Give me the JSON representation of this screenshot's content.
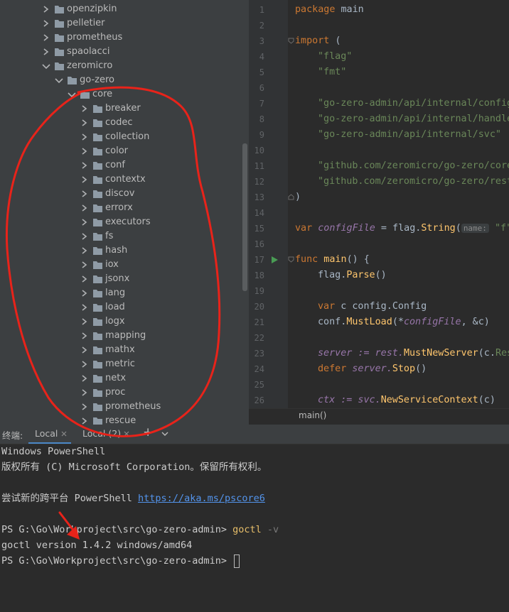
{
  "project_tree": {
    "items": [
      {
        "label": "openzipkin",
        "depth": 0,
        "expanded": false
      },
      {
        "label": "pelletier",
        "depth": 0,
        "expanded": false
      },
      {
        "label": "prometheus",
        "depth": 0,
        "expanded": false
      },
      {
        "label": "spaolacci",
        "depth": 0,
        "expanded": false
      },
      {
        "label": "zeromicro",
        "depth": 0,
        "expanded": true
      },
      {
        "label": "go-zero",
        "depth": 1,
        "expanded": true
      },
      {
        "label": "core",
        "depth": 2,
        "expanded": true
      },
      {
        "label": "breaker",
        "depth": 3,
        "expanded": false
      },
      {
        "label": "codec",
        "depth": 3,
        "expanded": false
      },
      {
        "label": "collection",
        "depth": 3,
        "expanded": false
      },
      {
        "label": "color",
        "depth": 3,
        "expanded": false
      },
      {
        "label": "conf",
        "depth": 3,
        "expanded": false
      },
      {
        "label": "contextx",
        "depth": 3,
        "expanded": false
      },
      {
        "label": "discov",
        "depth": 3,
        "expanded": false
      },
      {
        "label": "errorx",
        "depth": 3,
        "expanded": false
      },
      {
        "label": "executors",
        "depth": 3,
        "expanded": false
      },
      {
        "label": "fs",
        "depth": 3,
        "expanded": false
      },
      {
        "label": "hash",
        "depth": 3,
        "expanded": false
      },
      {
        "label": "iox",
        "depth": 3,
        "expanded": false
      },
      {
        "label": "jsonx",
        "depth": 3,
        "expanded": false
      },
      {
        "label": "lang",
        "depth": 3,
        "expanded": false
      },
      {
        "label": "load",
        "depth": 3,
        "expanded": false
      },
      {
        "label": "logx",
        "depth": 3,
        "expanded": false
      },
      {
        "label": "mapping",
        "depth": 3,
        "expanded": false
      },
      {
        "label": "mathx",
        "depth": 3,
        "expanded": false
      },
      {
        "label": "metric",
        "depth": 3,
        "expanded": false
      },
      {
        "label": "netx",
        "depth": 3,
        "expanded": false
      },
      {
        "label": "proc",
        "depth": 3,
        "expanded": false
      },
      {
        "label": "prometheus",
        "depth": 3,
        "expanded": false
      },
      {
        "label": "rescue",
        "depth": 3,
        "expanded": false
      }
    ]
  },
  "editor": {
    "line_numbers": [
      "1",
      "2",
      "3",
      "4",
      "5",
      "6",
      "7",
      "8",
      "9",
      "10",
      "11",
      "12",
      "13",
      "14",
      "15",
      "16",
      "17",
      "18",
      "19",
      "20",
      "21",
      "22",
      "23",
      "24",
      "25",
      "26"
    ],
    "breadcrumb": "main()",
    "code": {
      "l1_kw": "package",
      "l1_name": " main",
      "l3_kw": "import",
      "l3_paren": " (",
      "l4_str": "\"flag\"",
      "l5_str": "\"fmt\"",
      "l7_str": "\"go-zero-admin/api/internal/config\"",
      "l8_str": "\"go-zero-admin/api/internal/handler\"",
      "l9_str": "\"go-zero-admin/api/internal/svc\"",
      "l11_str": "\"github.com/zeromicro/go-zero/core/conf\"",
      "l12_str": "\"github.com/zeromicro/go-zero/rest\"",
      "l13_paren": ")",
      "l15_kw": "var",
      "l15_var": " configFile",
      "l15_mid": " = flag.",
      "l15_fn": "String",
      "l15_paren": "(",
      "l15_hint": "name:",
      "l15_str": " \"f\",",
      "l17_kw": "func",
      "l17_fn": " main",
      "l17_rest": "() {",
      "l18_a": "flag.",
      "l18_fn": "Parse",
      "l18_b": "()",
      "l20_kw": "var",
      "l20_rest": " c config.",
      "l20_type": "Config",
      "l21_a": "conf.",
      "l21_fn": "MustLoad",
      "l21_b": "(*",
      "l21_var": "configFile",
      "l21_c": ", &c)",
      "l23_a": "server := rest.",
      "l23_fn": "MustNewServer",
      "l23_b": "(c.",
      "l23_c": "RestConf)",
      "l24_kw": "defer",
      "l24_a": " server.",
      "l24_fn": "Stop",
      "l24_b": "()",
      "l26_a": "ctx := svc.",
      "l26_fn": "NewServiceContext",
      "l26_b": "(c)"
    }
  },
  "terminal": {
    "title": "终端:",
    "tabs": [
      {
        "label": "Local",
        "active": true
      },
      {
        "label": "Local (2)",
        "active": false
      }
    ],
    "add_tab": "+",
    "lines": {
      "banner": "Windows PowerShell",
      "copyright": "版权所有 (C) Microsoft Corporation。保留所有权利。",
      "try_prefix": "尝试新的跨平台 PowerShell ",
      "try_link": "https://aka.ms/pscore6",
      "prompt1": "PS G:\\Go\\Workproject\\src\\go-zero-admin> ",
      "cmd1": "goctl",
      "cmd1_arg": " -v",
      "output": "goctl version 1.4.2 windows/amd64",
      "prompt2": "PS G:\\Go\\Workproject\\src\\go-zero-admin> "
    }
  },
  "colors": {
    "annotation": "#e8231a",
    "folder": "#8f9ba6",
    "tab_underline": "#4a88c7"
  }
}
